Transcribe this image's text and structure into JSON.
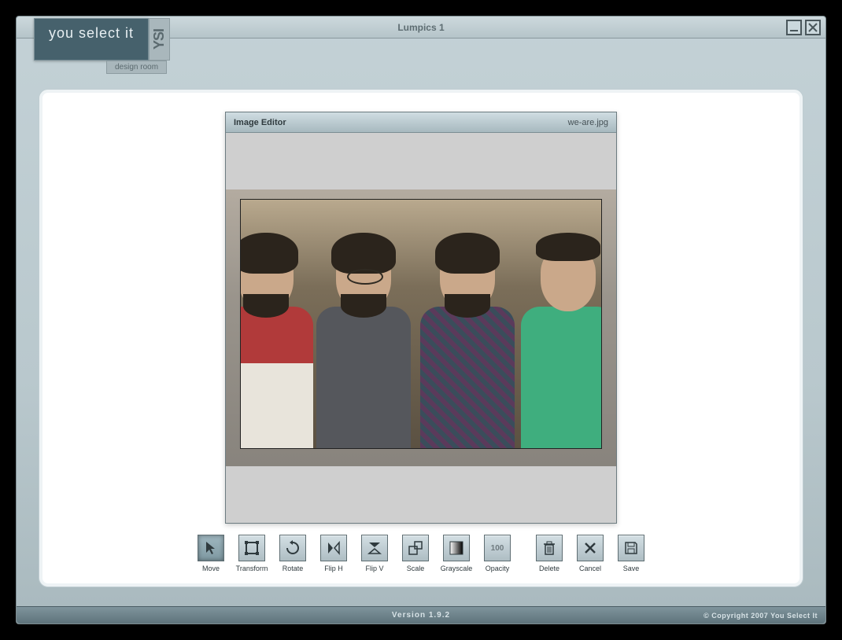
{
  "window": {
    "title": "Lumpics 1"
  },
  "branding": {
    "main": "you select it",
    "badge": "YSI",
    "sub": "design room"
  },
  "editor": {
    "title": "Image Editor",
    "filename": "we-are.jpg"
  },
  "toolbar": {
    "move": "Move",
    "transform": "Transform",
    "rotate": "Rotate",
    "fliph": "Flip H",
    "flipv": "Flip V",
    "scale": "Scale",
    "grayscale": "Grayscale",
    "opacity": "Opacity",
    "opacity_value": "100",
    "delete": "Delete",
    "cancel": "Cancel",
    "save": "Save"
  },
  "footer": {
    "version": "Version 1.9.2",
    "copyright": "© Copyright 2007 You Select It"
  }
}
